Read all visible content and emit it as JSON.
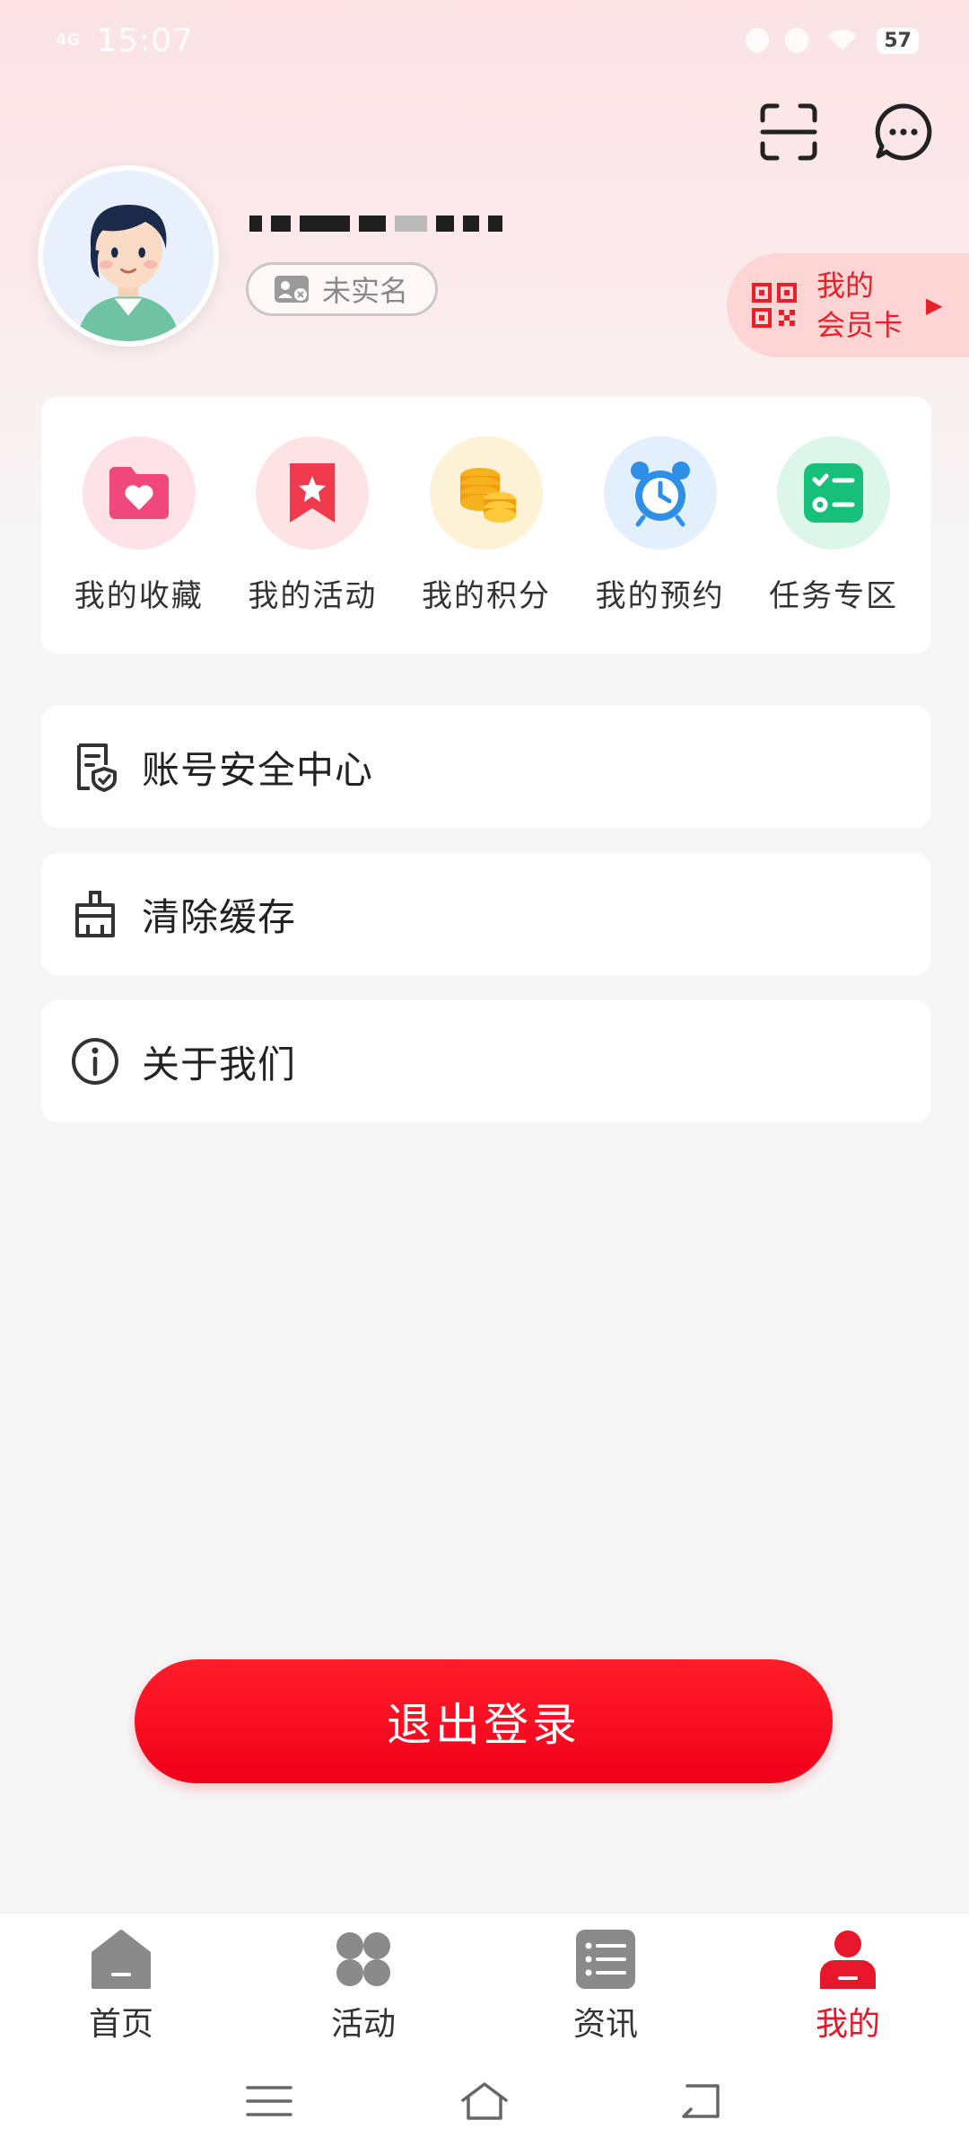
{
  "status_bar": {
    "network": "4G",
    "time": "15:07",
    "battery": "57"
  },
  "profile": {
    "realname_status": "未实名",
    "member_card": {
      "line1": "我的",
      "line2": "会员卡"
    }
  },
  "quick_menu": [
    {
      "label": "我的收藏",
      "icon": "heart-folder-icon",
      "bg": "#fde3e8"
    },
    {
      "label": "我的活动",
      "icon": "star-bookmark-icon",
      "bg": "#fde3e3"
    },
    {
      "label": "我的积分",
      "icon": "coins-icon",
      "bg": "#fdf1d6"
    },
    {
      "label": "我的预约",
      "icon": "alarm-clock-icon",
      "bg": "#e2f0fd"
    },
    {
      "label": "任务专区",
      "icon": "checklist-icon",
      "bg": "#dcf6ea"
    }
  ],
  "settings": {
    "account_security": "账号安全中心",
    "clear_cache": "清除缓存",
    "about_us": "关于我们"
  },
  "logout_label": "退出登录",
  "tabs": [
    {
      "label": "首页",
      "icon": "home-icon"
    },
    {
      "label": "活动",
      "icon": "grid-icon"
    },
    {
      "label": "资讯",
      "icon": "news-list-icon"
    },
    {
      "label": "我的",
      "icon": "person-icon",
      "active": true
    }
  ],
  "colors": {
    "accent": "#e8162a",
    "member_card_bg": "#fdd5d5"
  }
}
